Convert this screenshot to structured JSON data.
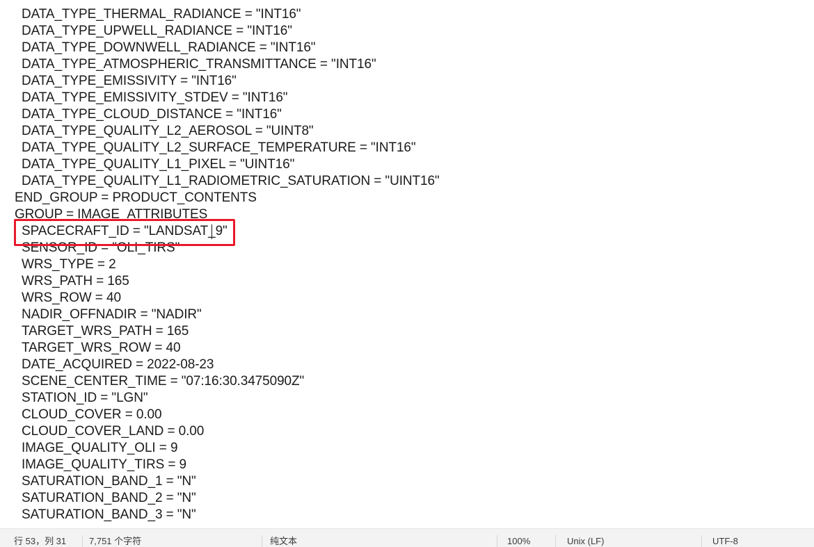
{
  "editor": {
    "lines": [
      {
        "indent": 1,
        "text": "DATA_TYPE_THERMAL_RADIANCE = \"INT16\""
      },
      {
        "indent": 1,
        "text": "DATA_TYPE_UPWELL_RADIANCE = \"INT16\""
      },
      {
        "indent": 1,
        "text": "DATA_TYPE_DOWNWELL_RADIANCE = \"INT16\""
      },
      {
        "indent": 1,
        "text": "DATA_TYPE_ATMOSPHERIC_TRANSMITTANCE = \"INT16\""
      },
      {
        "indent": 1,
        "text": "DATA_TYPE_EMISSIVITY = \"INT16\""
      },
      {
        "indent": 1,
        "text": "DATA_TYPE_EMISSIVITY_STDEV = \"INT16\""
      },
      {
        "indent": 1,
        "text": "DATA_TYPE_CLOUD_DISTANCE = \"INT16\""
      },
      {
        "indent": 1,
        "text": "DATA_TYPE_QUALITY_L2_AEROSOL = \"UINT8\""
      },
      {
        "indent": 1,
        "text": "DATA_TYPE_QUALITY_L2_SURFACE_TEMPERATURE = \"INT16\""
      },
      {
        "indent": 1,
        "text": "DATA_TYPE_QUALITY_L1_PIXEL = \"UINT16\""
      },
      {
        "indent": 1,
        "text": "DATA_TYPE_QUALITY_L1_RADIOMETRIC_SATURATION = \"UINT16\""
      },
      {
        "indent": 0,
        "text": "END_GROUP = PRODUCT_CONTENTS"
      },
      {
        "indent": 0,
        "text": "GROUP = IMAGE_ATTRIBUTES"
      },
      {
        "indent": 1,
        "text": "SPACECRAFT_ID = \"LANDSAT_9\""
      },
      {
        "indent": 1,
        "text": "SENSOR_ID = \"OLI_TIRS\""
      },
      {
        "indent": 1,
        "text": "WRS_TYPE = 2"
      },
      {
        "indent": 1,
        "text": "WRS_PATH = 165"
      },
      {
        "indent": 1,
        "text": "WRS_ROW = 40"
      },
      {
        "indent": 1,
        "text": "NADIR_OFFNADIR = \"NADIR\""
      },
      {
        "indent": 1,
        "text": "TARGET_WRS_PATH = 165"
      },
      {
        "indent": 1,
        "text": "TARGET_WRS_ROW = 40"
      },
      {
        "indent": 1,
        "text": "DATE_ACQUIRED = 2022-08-23"
      },
      {
        "indent": 1,
        "text": "SCENE_CENTER_TIME = \"07:16:30.3475090Z\""
      },
      {
        "indent": 1,
        "text": "STATION_ID = \"LGN\""
      },
      {
        "indent": 1,
        "text": "CLOUD_COVER = 0.00"
      },
      {
        "indent": 1,
        "text": "CLOUD_COVER_LAND = 0.00"
      },
      {
        "indent": 1,
        "text": "IMAGE_QUALITY_OLI = 9"
      },
      {
        "indent": 1,
        "text": "IMAGE_QUALITY_TIRS = 9"
      },
      {
        "indent": 1,
        "text": "SATURATION_BAND_1 = \"N\""
      },
      {
        "indent": 1,
        "text": "SATURATION_BAND_2 = \"N\""
      },
      {
        "indent": 1,
        "text": "SATURATION_BAND_3 = \"N\""
      }
    ],
    "highlight_color": "#e8192c"
  },
  "statusbar": {
    "cursor_position": "行 53，列 31",
    "char_count": "7,751 个字符",
    "file_type": "纯文本",
    "zoom": "100%",
    "line_ending": "Unix (LF)",
    "encoding": "UTF-8"
  }
}
